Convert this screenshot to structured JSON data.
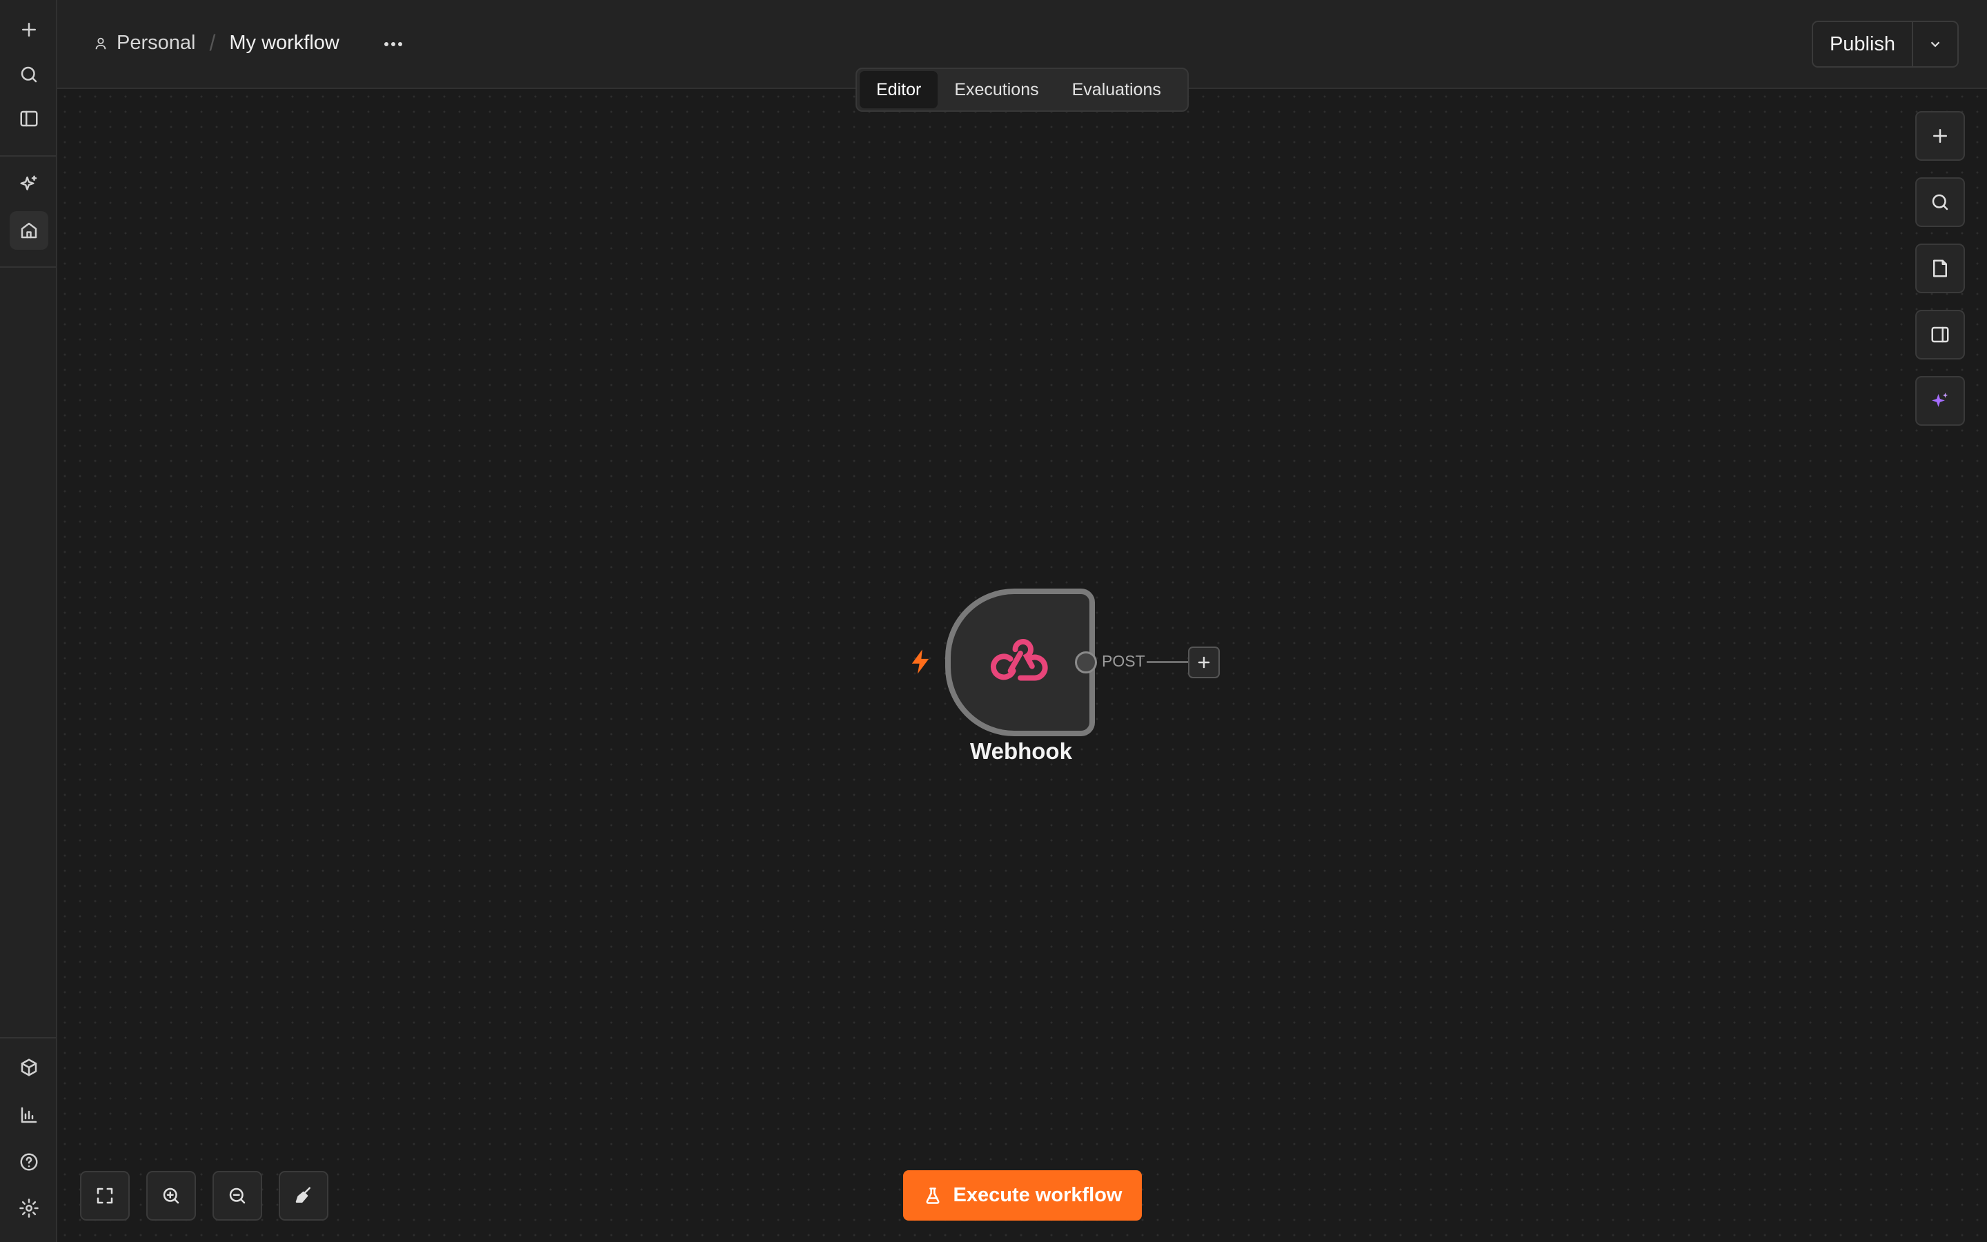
{
  "header": {
    "project": "Personal",
    "separator": "/",
    "workflow_title": "My workflow",
    "more_label": "···",
    "publish_label": "Publish"
  },
  "tabs": [
    {
      "label": "Editor",
      "active": true
    },
    {
      "label": "Executions",
      "active": false
    },
    {
      "label": "Evaluations",
      "active": false
    }
  ],
  "sidebar": {
    "top_items": [
      "plus-icon",
      "search-icon",
      "panel-icon",
      "sparkles-icon",
      "home-icon"
    ],
    "bottom_items": [
      "cube-icon",
      "bar-chart-icon",
      "help-icon",
      "settings-icon"
    ]
  },
  "canvas": {
    "node": {
      "name": "Webhook",
      "icon": "webhook-icon",
      "output_label": "POST",
      "trigger": "bolt-icon"
    }
  },
  "right_tools": [
    "plus-icon",
    "search-icon",
    "sticky-note-icon",
    "panel-right-icon",
    "ai-sparkle-icon"
  ],
  "bottom_tools": [
    "fit-view-icon",
    "zoom-in-icon",
    "zoom-out-icon",
    "clean-up-icon"
  ],
  "execute": {
    "label": "Execute workflow"
  },
  "colors": {
    "accent": "#ff6d1a",
    "webhook": "#e8457a",
    "ai": "#a66dff"
  }
}
